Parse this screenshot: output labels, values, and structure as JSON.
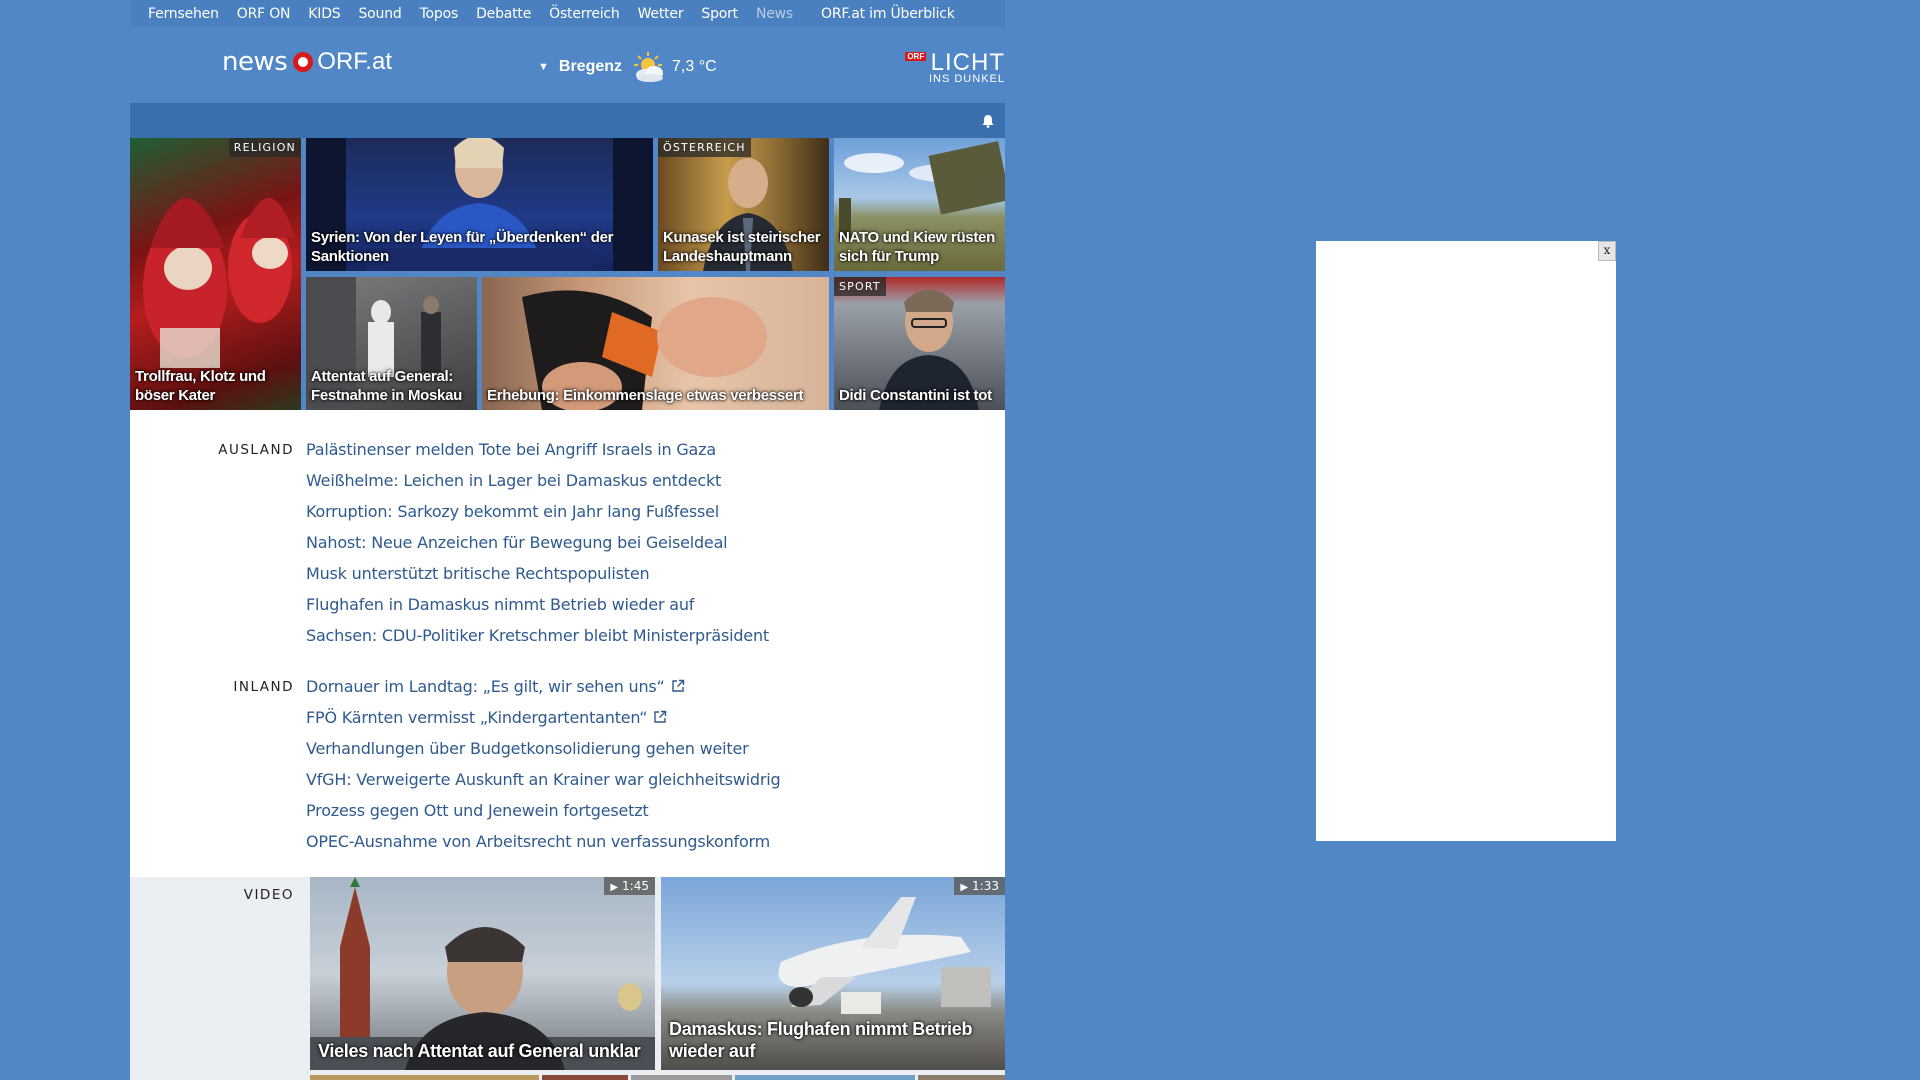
{
  "nav": {
    "items": [
      "Fernsehen",
      "ORF ON",
      "KIDS",
      "Sound",
      "Topos",
      "Debatte",
      "Österreich",
      "Wetter",
      "Sport",
      "News"
    ],
    "active": "News",
    "overview": "ORF.at im Überblick"
  },
  "header": {
    "logo_news": "news",
    "logo_orf": "ORF.at",
    "weather_location": "Bregenz",
    "weather_temp": "7,3 °C",
    "weather_icon": "partly-cloudy-icon",
    "licht_badge": "ORF",
    "licht_title": "LICHT",
    "licht_sub": "INS DUNKEL"
  },
  "teasers": [
    {
      "kicker": "RELIGION",
      "caption": "Trollfrau, Klotz und böser Kater"
    },
    {
      "kicker": "",
      "caption": "Syrien: Von der Leyen für „Überdenken“ der Sanktionen"
    },
    {
      "kicker": "ÖSTERREICH",
      "caption": "Kunasek ist steirischer Landeshauptmann"
    },
    {
      "kicker": "",
      "caption": "NATO und Kiew rüsten sich für Trump"
    },
    {
      "kicker": "",
      "caption": "Attentat auf General: Festnahme in Moskau"
    },
    {
      "kicker": "",
      "caption": "Erhebung: Einkommenslage etwas verbessert"
    },
    {
      "kicker": "SPORT",
      "caption": "Didi Constantini ist tot"
    }
  ],
  "sections": {
    "ausland": {
      "label": "AUSLAND",
      "stories": [
        "Palästinenser melden Tote bei Angriff Israels in Gaza",
        "Weißhelme: Leichen in Lager bei Damaskus entdeckt",
        "Korruption: Sarkozy bekommt ein Jahr lang Fußfessel",
        "Nahost: Neue Anzeichen für Bewegung bei Geiseldeal",
        "Musk unterstützt britische Rechtspopulisten",
        "Flughafen in Damaskus nimmt Betrieb wieder auf",
        "Sachsen: CDU-Politiker Kretschmer bleibt Ministerpräsident"
      ]
    },
    "inland": {
      "label": "INLAND",
      "stories": [
        "Dornauer im Landtag: „Es gilt, wir sehen uns“",
        "FPÖ Kärnten vermisst „Kindergartentanten“",
        "Verhandlungen über Budgetkonsolidierung gehen weiter",
        "VfGH: Verweigerte Auskunft an Krainer war gleichheitswidrig",
        "Prozess gegen Ott und Jenewein fortgesetzt",
        "OPEC-Ausnahme von Arbeitsrecht nun verfassungskonform"
      ]
    }
  },
  "video": {
    "label": "VIDEO",
    "items": [
      {
        "duration": "1:45",
        "caption": "Vieles nach Attentat auf General unklar"
      },
      {
        "duration": "1:33",
        "caption": "Damaskus: Flughafen nimmt Betrieb wieder auf"
      }
    ]
  },
  "ad": {
    "close": "x"
  }
}
